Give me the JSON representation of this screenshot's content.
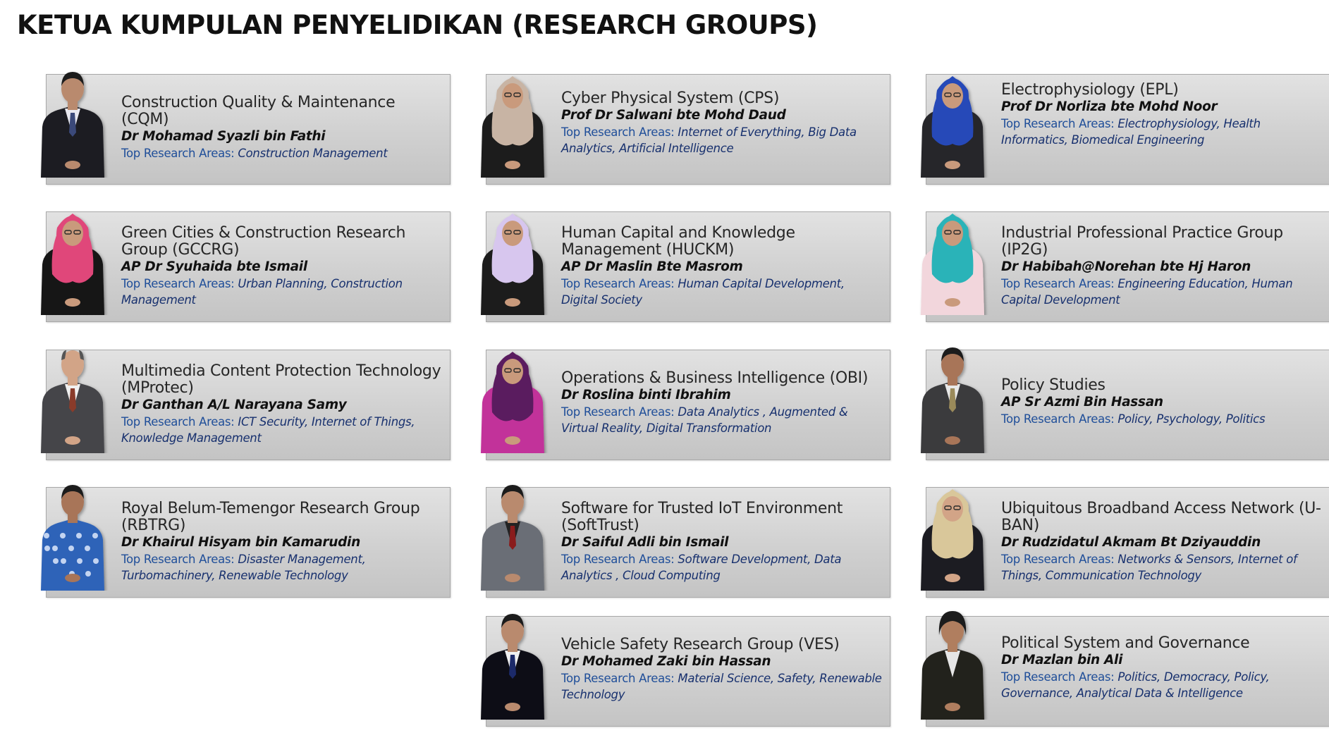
{
  "page": {
    "title": "KETUA KUMPULAN PENYELIDIKAN (RESEARCH GROUPS)"
  },
  "areas_label": "Top Research Areas: ",
  "colors": {
    "card_top": "#e2e2e2",
    "card_bottom": "#c4c4c4",
    "areas_label": "#1f4e99",
    "areas_value": "#17306e"
  },
  "groups": [
    {
      "name": "Construction Quality & Maintenance (CQM)",
      "leader": "Dr Mohamad Syazli bin Fathi",
      "areas": "Construction Management"
    },
    {
      "name": "Cyber Physical System (CPS)",
      "leader": "Prof Dr Salwani bte Mohd Daud",
      "areas": "Internet of Everything, Big Data Analytics, Artificial Intelligence"
    },
    {
      "name": "Electrophysiology (EPL)",
      "leader": "Prof Dr Norliza bte Mohd Noor",
      "areas": "Electrophysiology, Health Informatics, Biomedical Engineering"
    },
    {
      "name": "Green Cities & Construction Research Group (GCCRG)",
      "leader": "AP Dr Syuhaida bte Ismail",
      "areas": "Urban Planning, Construction Management"
    },
    {
      "name": "Human Capital and Knowledge Management (HUCKM)",
      "leader": "AP Dr Maslin Bte Masrom",
      "areas": "Human Capital Development, Digital Society"
    },
    {
      "name": "Industrial Professional Practice Group (IP2G)",
      "leader": "Dr Habibah@Norehan bte Hj Haron",
      "areas": "Engineering Education, Human Capital Development"
    },
    {
      "name": "Multimedia Content Protection Technology (MProtec)",
      "leader": "Dr Ganthan A/L Narayana Samy",
      "areas": "ICT Security, Internet of Things, Knowledge Management"
    },
    {
      "name": "Operations & Business Intelligence (OBI)",
      "leader": "Dr Roslina binti Ibrahim",
      "areas": "Data Analytics , Augmented & Virtual Reality, Digital Transformation"
    },
    {
      "name": "Policy Studies",
      "leader": "AP Sr Azmi Bin Hassan",
      "areas": "Policy, Psychology, Politics"
    },
    {
      "name": "Royal Belum-Temengor Research Group (RBTRG)",
      "leader": "Dr Khairul Hisyam bin Kamarudin",
      "areas": "Disaster Management, Turbomachinery, Renewable Technology"
    },
    {
      "name": "Software for Trusted IoT Environment (SoftTrust)",
      "leader": "Dr Saiful Adli bin Ismail",
      "areas": "Software Development, Data Analytics , Cloud Computing"
    },
    {
      "name": "Ubiquitous Broadband Access Network (U-BAN)",
      "leader": "Dr Rudzidatul Akmam Bt Dziyauddin",
      "areas": "Networks & Sensors, Internet of Things, Communication Technology"
    },
    {
      "name": "Vehicle Safety Research Group (VES)",
      "leader": "Dr Mohamed Zaki bin Hassan",
      "areas": "Material Science, Safety, Renewable Technology"
    },
    {
      "name": "Political System and Governance",
      "leader": "Dr Mazlan bin Ali",
      "areas": "Politics, Democracy, Policy, Governance, Analytical Data & Intelligence"
    }
  ]
}
